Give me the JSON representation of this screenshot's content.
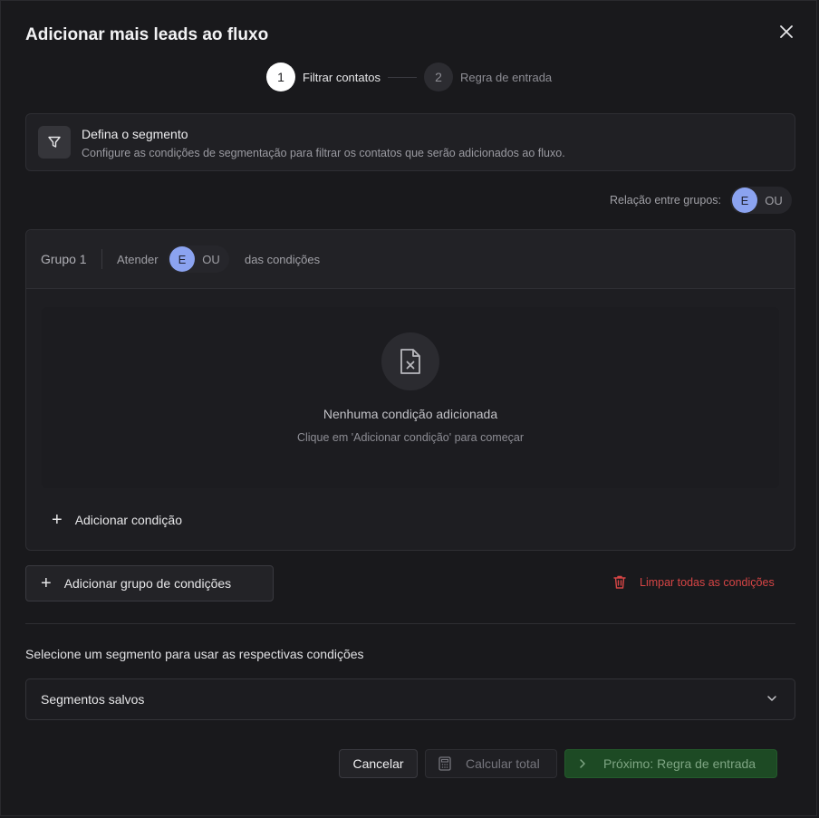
{
  "dialog": {
    "title": "Adicionar mais leads ao fluxo"
  },
  "stepper": [
    {
      "number": "1",
      "label": "Filtrar contatos"
    },
    {
      "number": "2",
      "label": "Regra de entrada"
    }
  ],
  "segment_card": {
    "title": "Defina o segmento",
    "description": "Configure as condições de segmentação para filtrar os contatos que serão adicionados ao fluxo."
  },
  "group_relation": {
    "label": "Relação entre grupos:",
    "and": "E",
    "or": "OU"
  },
  "group": {
    "name": "Grupo 1",
    "match_prefix": "Atender",
    "and": "E",
    "or": "OU",
    "match_suffix": "das condições",
    "empty_title": "Nenhuma condição adicionada",
    "empty_subtitle": "Clique em 'Adicionar condição' para começar",
    "add_condition": "Adicionar condição"
  },
  "actions": {
    "add_group": "Adicionar grupo de condições",
    "clear_all": "Limpar todas as condições"
  },
  "saved_segments": {
    "hint": "Selecione um segmento para usar as respectivas condições",
    "select_value": "Segmentos salvos"
  },
  "footer": {
    "cancel": "Cancelar",
    "calculate": "Calcular total",
    "next": "Próximo: Regra de entrada"
  },
  "colors": {
    "accent_toggle": "#8ba3f0",
    "danger": "#d64545",
    "next_button_bg": "#1d4a24"
  }
}
